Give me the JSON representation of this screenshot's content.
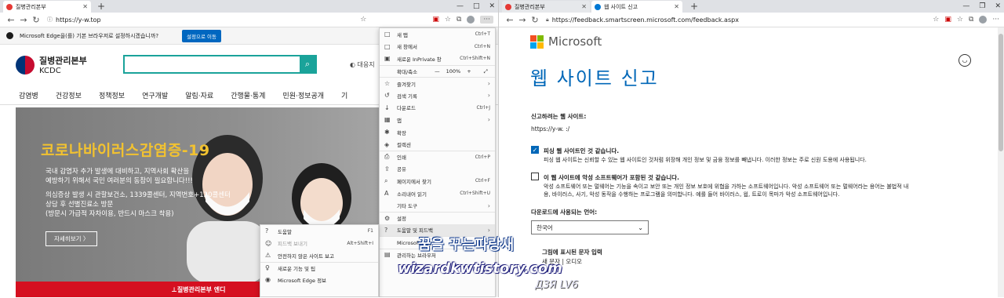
{
  "left": {
    "tab": {
      "label": "질병관리본부"
    },
    "address": {
      "url": "https://y-w.top"
    },
    "infobar": {
      "text": "Microsoft Edge을(를) 기본 브라우저로 설정하시겠습니까?",
      "button": "설정으로 이동"
    },
    "site": {
      "logo_name": "질병관리본부",
      "logo_sub": "KCDC",
      "side_link": "대응지",
      "nav": [
        "감염병",
        "건강정보",
        "정책정보",
        "연구개발",
        "알림·자료",
        "간행물·통계",
        "민원·정보공개",
        "기"
      ],
      "banner": {
        "title": "코로나바이러스감염증-19",
        "para1": "국내 감염자 추가 발생에 대비하고, 지역사회 확산을\n예방하기 위해서 국민 여러분의 동참이 필요합니다!!!",
        "para2": "의심증상 발생 시 관할보건소, 1339콜센터, 지역번호+120콜센터\n상담 후 선별진료소 방문\n(방문시 가급적 자차이용, 반드시 마스크 착용)",
        "more": "자세히보기 〉"
      },
      "bottom_strip": "⊥질병관리본부 엔디"
    },
    "menu": {
      "items": [
        {
          "icon": "□",
          "label": "새 탭",
          "shortcut": "Ctrl+T"
        },
        {
          "icon": "□",
          "label": "새 창에서",
          "shortcut": "Ctrl+N"
        },
        {
          "icon": "▣",
          "label": "새로운 InPrivate 창",
          "shortcut": "Ctrl+Shift+N"
        },
        {
          "icon": "",
          "label": "확대/축소",
          "shortcut": ""
        },
        {
          "icon": "☆",
          "label": "즐겨찾기",
          "shortcut": "›"
        },
        {
          "icon": "↺",
          "label": "검색 기록",
          "shortcut": "›"
        },
        {
          "icon": "↓",
          "label": "다운로드",
          "shortcut": "Ctrl+J"
        },
        {
          "icon": "▦",
          "label": "앱",
          "shortcut": "›"
        },
        {
          "icon": "✱",
          "label": "확장",
          "shortcut": ""
        },
        {
          "icon": "◈",
          "label": "컬렉션",
          "shortcut": ""
        },
        {
          "icon": "⎙",
          "label": "인쇄",
          "shortcut": "Ctrl+P"
        },
        {
          "icon": "⇪",
          "label": "공유",
          "shortcut": ""
        },
        {
          "icon": "⌕",
          "label": "페이지에서 찾기",
          "shortcut": "Ctrl+F"
        },
        {
          "icon": "A",
          "label": "소리내어 읽기",
          "shortcut": "Ctrl+Shift+U"
        },
        {
          "icon": "",
          "label": "기타 도구",
          "shortcut": "›"
        },
        {
          "icon": "⚙",
          "label": "설정",
          "shortcut": ""
        },
        {
          "icon": "?",
          "label": "도움말 및 피드백",
          "shortcut": "›"
        },
        {
          "icon": "",
          "label": "Microsoft Edge 닫",
          "shortcut": ""
        },
        {
          "icon": "▤",
          "label": "관리하는 브라우저",
          "shortcut": ""
        }
      ],
      "zoom": {
        "minus": "—",
        "value": "100%",
        "plus": "+",
        "expand": "⤢"
      }
    },
    "submenu": {
      "items": [
        {
          "icon": "?",
          "label": "도움말",
          "shortcut": "F1"
        },
        {
          "icon": "☺",
          "label": "피드백 보내기",
          "shortcut": "Alt+Shift+I"
        },
        {
          "icon": "⚠",
          "label": "안전하지 않은 사이트 보고",
          "shortcut": ""
        },
        {
          "icon": "♀",
          "label": "새로운 기능 및 팁",
          "shortcut": ""
        },
        {
          "icon": "◉",
          "label": "Microsoft Edge 정보",
          "shortcut": ""
        }
      ]
    }
  },
  "right": {
    "tabs": [
      {
        "label": "질병관리본부"
      },
      {
        "label": "웹 사이트 신고"
      }
    ],
    "address": {
      "url": "https://feedback.smartscreen.microsoft.com/feedback.aspx"
    },
    "ms_name": "Microsoft",
    "title": "웹 사이트 신고",
    "site_label": "신고하려는 웹 사이트:",
    "site_value": "https://y-w.   :/",
    "opt1_title": "피싱 웹 사이트인 것 같습니다.",
    "opt1_desc": "피싱 웹 사이트는 신뢰할 수 있는 웹 사이트인 것처럼 위장해 개인 정보 및 금융 정보를 빼냅니다. 이러한 정보는 주로 신원 도용에 사용됩니다.",
    "opt2_title": "이 웹 사이트에 악성 소프트웨어가 포함된 것 같습니다.",
    "opt2_desc1": "악성 소프트웨어 또는 멀웨어는 기능을 속이고 보안 또는 개인 정보 보호에 위협을 가하는 소프트웨어입니다. 악성 소프트웨어 또는 멀웨어라는 용어는 불법적 내",
    "opt2_desc2": "용, 바이러스, 사기, 악성 동작을 수행하는 프로그램을 의미합니다. 예를 들어 바이러스, 웜, 트로이 목마가 악성 소프트웨어입니다.",
    "lang_label": "다운로드에 사용되는 언어:",
    "lang_value": "한국어",
    "captcha_label": "그림에 표시된 문자 입력",
    "captcha_links": "새 문자 | 오디오"
  },
  "watermark": {
    "line1": "꿈을 꾸는파랑새",
    "line2": "wizardkwtistory.com",
    "line3": "ДЗЯ LV6"
  }
}
